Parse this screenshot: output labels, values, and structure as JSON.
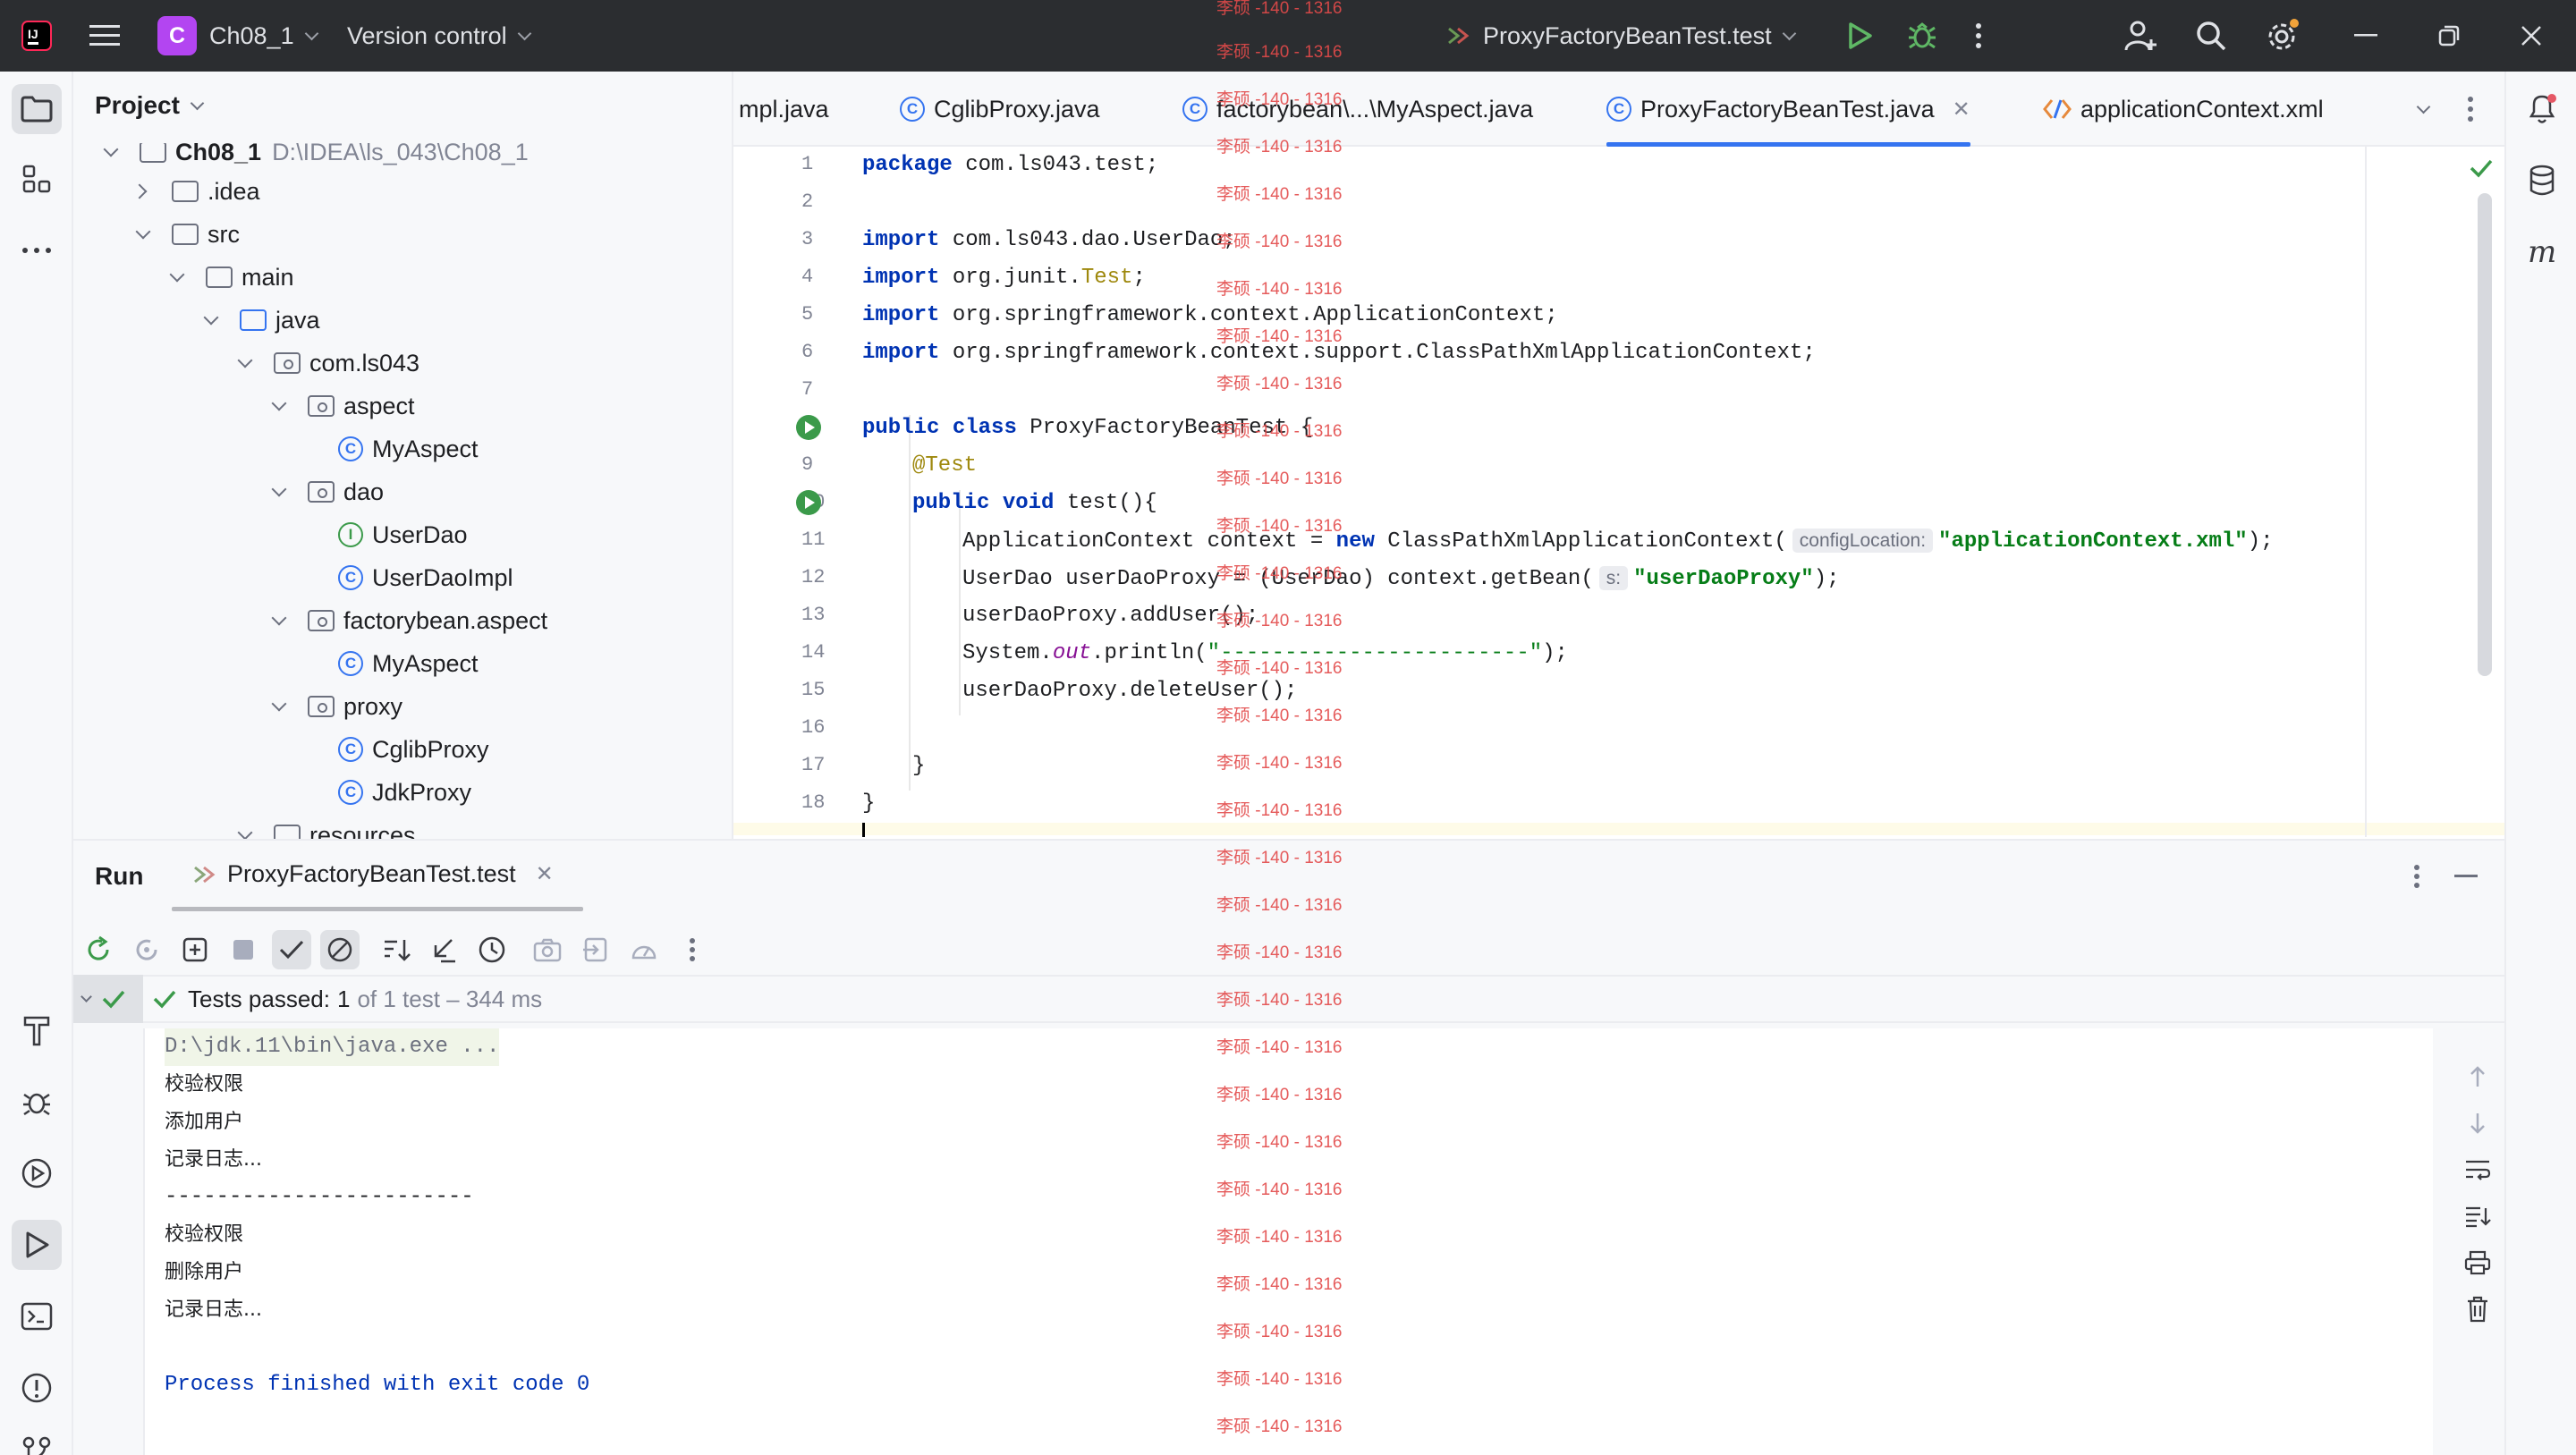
{
  "titlebar": {
    "project_letter": "C",
    "project_name": "Ch08_1",
    "vcs": "Version control",
    "run_config": "ProxyFactoryBeanTest.test"
  },
  "project": {
    "title": "Project",
    "root_name": "Ch08_1",
    "root_path": "D:\\IDEA\\ls_043\\Ch08_1",
    "items": [
      {
        "label": ".idea"
      },
      {
        "label": "src"
      },
      {
        "label": "main"
      },
      {
        "label": "java"
      },
      {
        "label": "com.ls043"
      },
      {
        "label": "aspect"
      },
      {
        "label": "MyAspect"
      },
      {
        "label": "dao"
      },
      {
        "label": "UserDao"
      },
      {
        "label": "UserDaoImpl"
      },
      {
        "label": "factorybean.aspect"
      },
      {
        "label": "MyAspect"
      },
      {
        "label": "proxy"
      },
      {
        "label": "CglibProxy"
      },
      {
        "label": "JdkProxy"
      },
      {
        "label": "resources"
      }
    ]
  },
  "tabs": [
    {
      "label": "mpl.java"
    },
    {
      "label": "CglibProxy.java"
    },
    {
      "label": "factorybean\\...\\MyAspect.java"
    },
    {
      "label": "ProxyFactoryBeanTest.java"
    },
    {
      "label": "applicationContext.xml"
    }
  ],
  "code": {
    "line_numbers": [
      "1",
      "2",
      "3",
      "4",
      "5",
      "6",
      "7",
      "8",
      "9",
      "10",
      "11",
      "12",
      "13",
      "14",
      "15",
      "16",
      "17",
      "18"
    ],
    "l1_kw": "package",
    "l1_rest": " com.ls043.test;",
    "l3_kw": "import",
    "l3_rest": " com.ls043.dao.UserDao;",
    "l4_kw": "import",
    "l4_a": " org.junit.",
    "l4_b": "Test",
    "l4_c": ";",
    "l5_kw": "import",
    "l5_rest": " org.springframework.context.ApplicationContext;",
    "l6_kw": "import",
    "l6_rest": " org.springframework.context.support.ClassPathXmlApplicationContext;",
    "l8_kw1": "public",
    "l8_kw2": "class",
    "l8_rest": " ProxyFactoryBeanTest {",
    "l9_ann": "@Test",
    "l10_kw1": "public",
    "l10_kw2": "void",
    "l10_rest": " test(){",
    "l11_a": "ApplicationContext context = ",
    "l11_kw": "new",
    "l11_b": " ClassPathXmlApplicationContext(",
    "l11_hint": "configLocation:",
    "l11_str": "\"applicationContext.xml\"",
    "l11_c": ");",
    "l12_a": "UserDao userDaoProxy = (UserDao) context.getBean(",
    "l12_hint": "s:",
    "l12_str": "\"userDaoProxy\"",
    "l12_c": ");",
    "l13": "userDaoProxy.addUser();",
    "l14_a": "System.",
    "l14_fld": "out",
    "l14_b": ".println(",
    "l14_str": "\"------------------------\"",
    "l14_c": ");",
    "l15": "userDaoProxy.deleteUser();",
    "l17": "}",
    "l18": "}"
  },
  "run": {
    "title": "Run",
    "tab": "ProxyFactoryBeanTest.test",
    "status_prefix": "Tests passed:",
    "status_count": "1",
    "status_rest": "of 1 test – 344 ms",
    "console": [
      "D:\\jdk.11\\bin\\java.exe ...",
      "校验权限",
      "添加用户",
      "记录日志...",
      "------------------------",
      "校验权限",
      "删除用户",
      "记录日志...",
      "",
      "Process finished with exit code 0"
    ]
  },
  "watermark": "李硕 -140 - 1316",
  "colors": {
    "accent": "#3574f0",
    "keyword": "#0033b3",
    "string": "#067d17",
    "annotation": "#9e880d",
    "success": "#3b9a4a",
    "watermark": "#e34a4a"
  }
}
